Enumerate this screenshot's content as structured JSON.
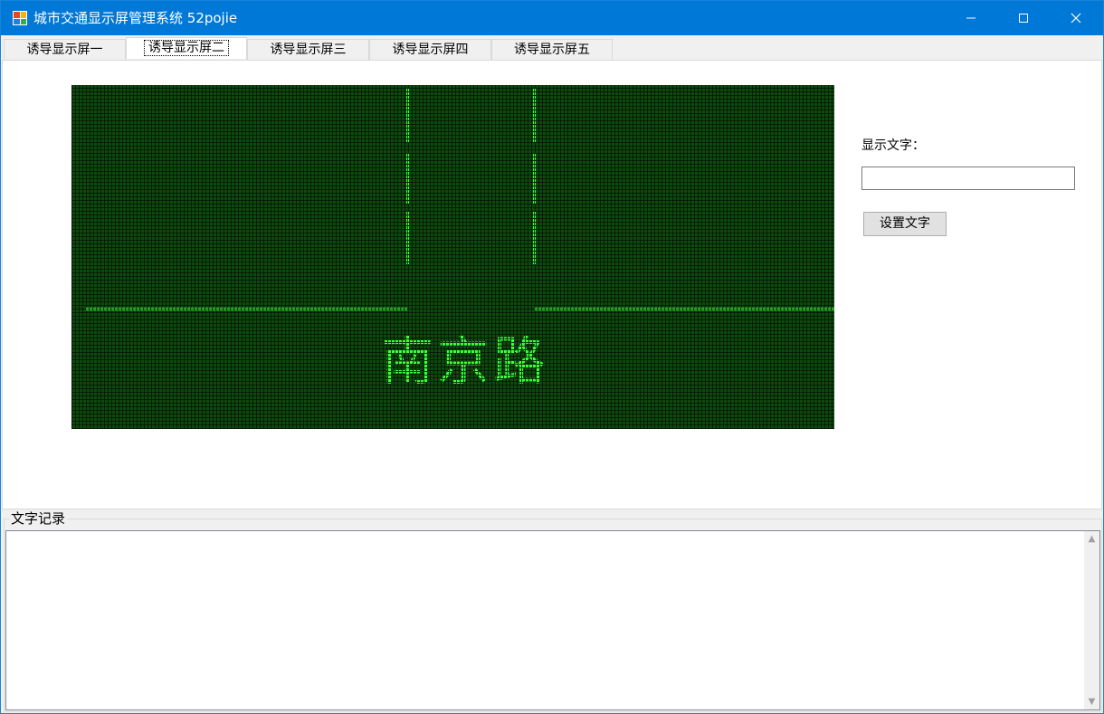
{
  "window": {
    "title": "城市交通显示屏管理系统 52pojie",
    "icons": [
      "app-icon",
      "minimize-icon",
      "maximize-icon",
      "close-icon"
    ],
    "accent_color": "#0078d7"
  },
  "tabs": [
    {
      "label": "诱导显示屏一",
      "active": false
    },
    {
      "label": "诱导显示屏二",
      "active": true
    },
    {
      "label": "诱导显示屏三",
      "active": false
    },
    {
      "label": "诱导显示屏四",
      "active": false
    },
    {
      "label": "诱导显示屏五",
      "active": false
    }
  ],
  "led_screen": {
    "road_name": "南京路",
    "background_color": "#0d4a0d",
    "lit_color": "#3cff3c"
  },
  "controls": {
    "display_label": "显示文字：",
    "display_input_value": "",
    "set_button_label": "设置文字"
  },
  "log_group": {
    "title": "文字记录",
    "content": ""
  }
}
